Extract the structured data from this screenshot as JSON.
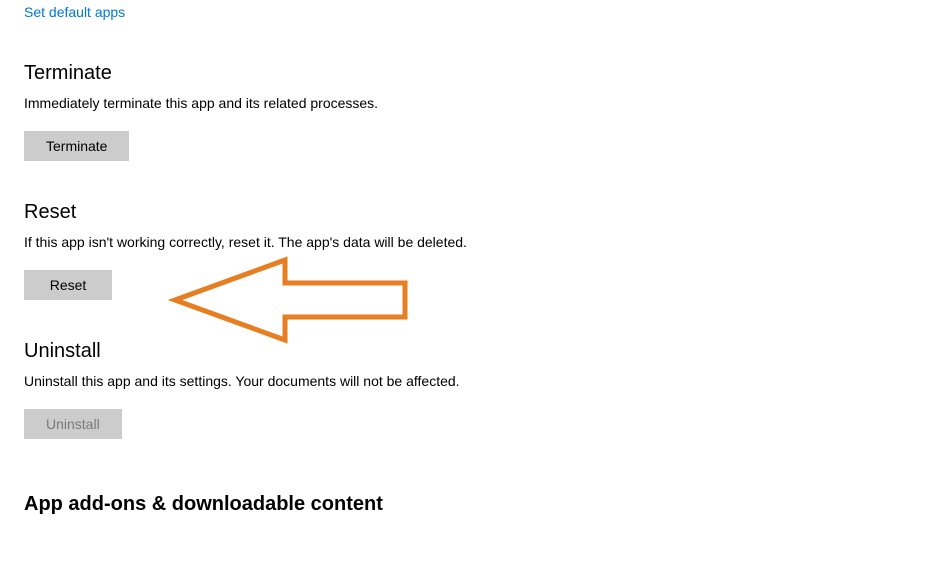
{
  "topLink": {
    "label": "Set default apps"
  },
  "terminate": {
    "title": "Terminate",
    "description": "Immediately terminate this app and its related processes.",
    "buttonLabel": "Terminate"
  },
  "reset": {
    "title": "Reset",
    "description": "If this app isn't working correctly, reset it. The app's data will be deleted.",
    "buttonLabel": "Reset"
  },
  "uninstall": {
    "title": "Uninstall",
    "description": "Uninstall this app and its settings. Your documents will not be affected.",
    "buttonLabel": "Uninstall"
  },
  "addons": {
    "title": "App add-ons & downloadable content"
  },
  "annotation": {
    "arrowColor": "#e67e22"
  }
}
